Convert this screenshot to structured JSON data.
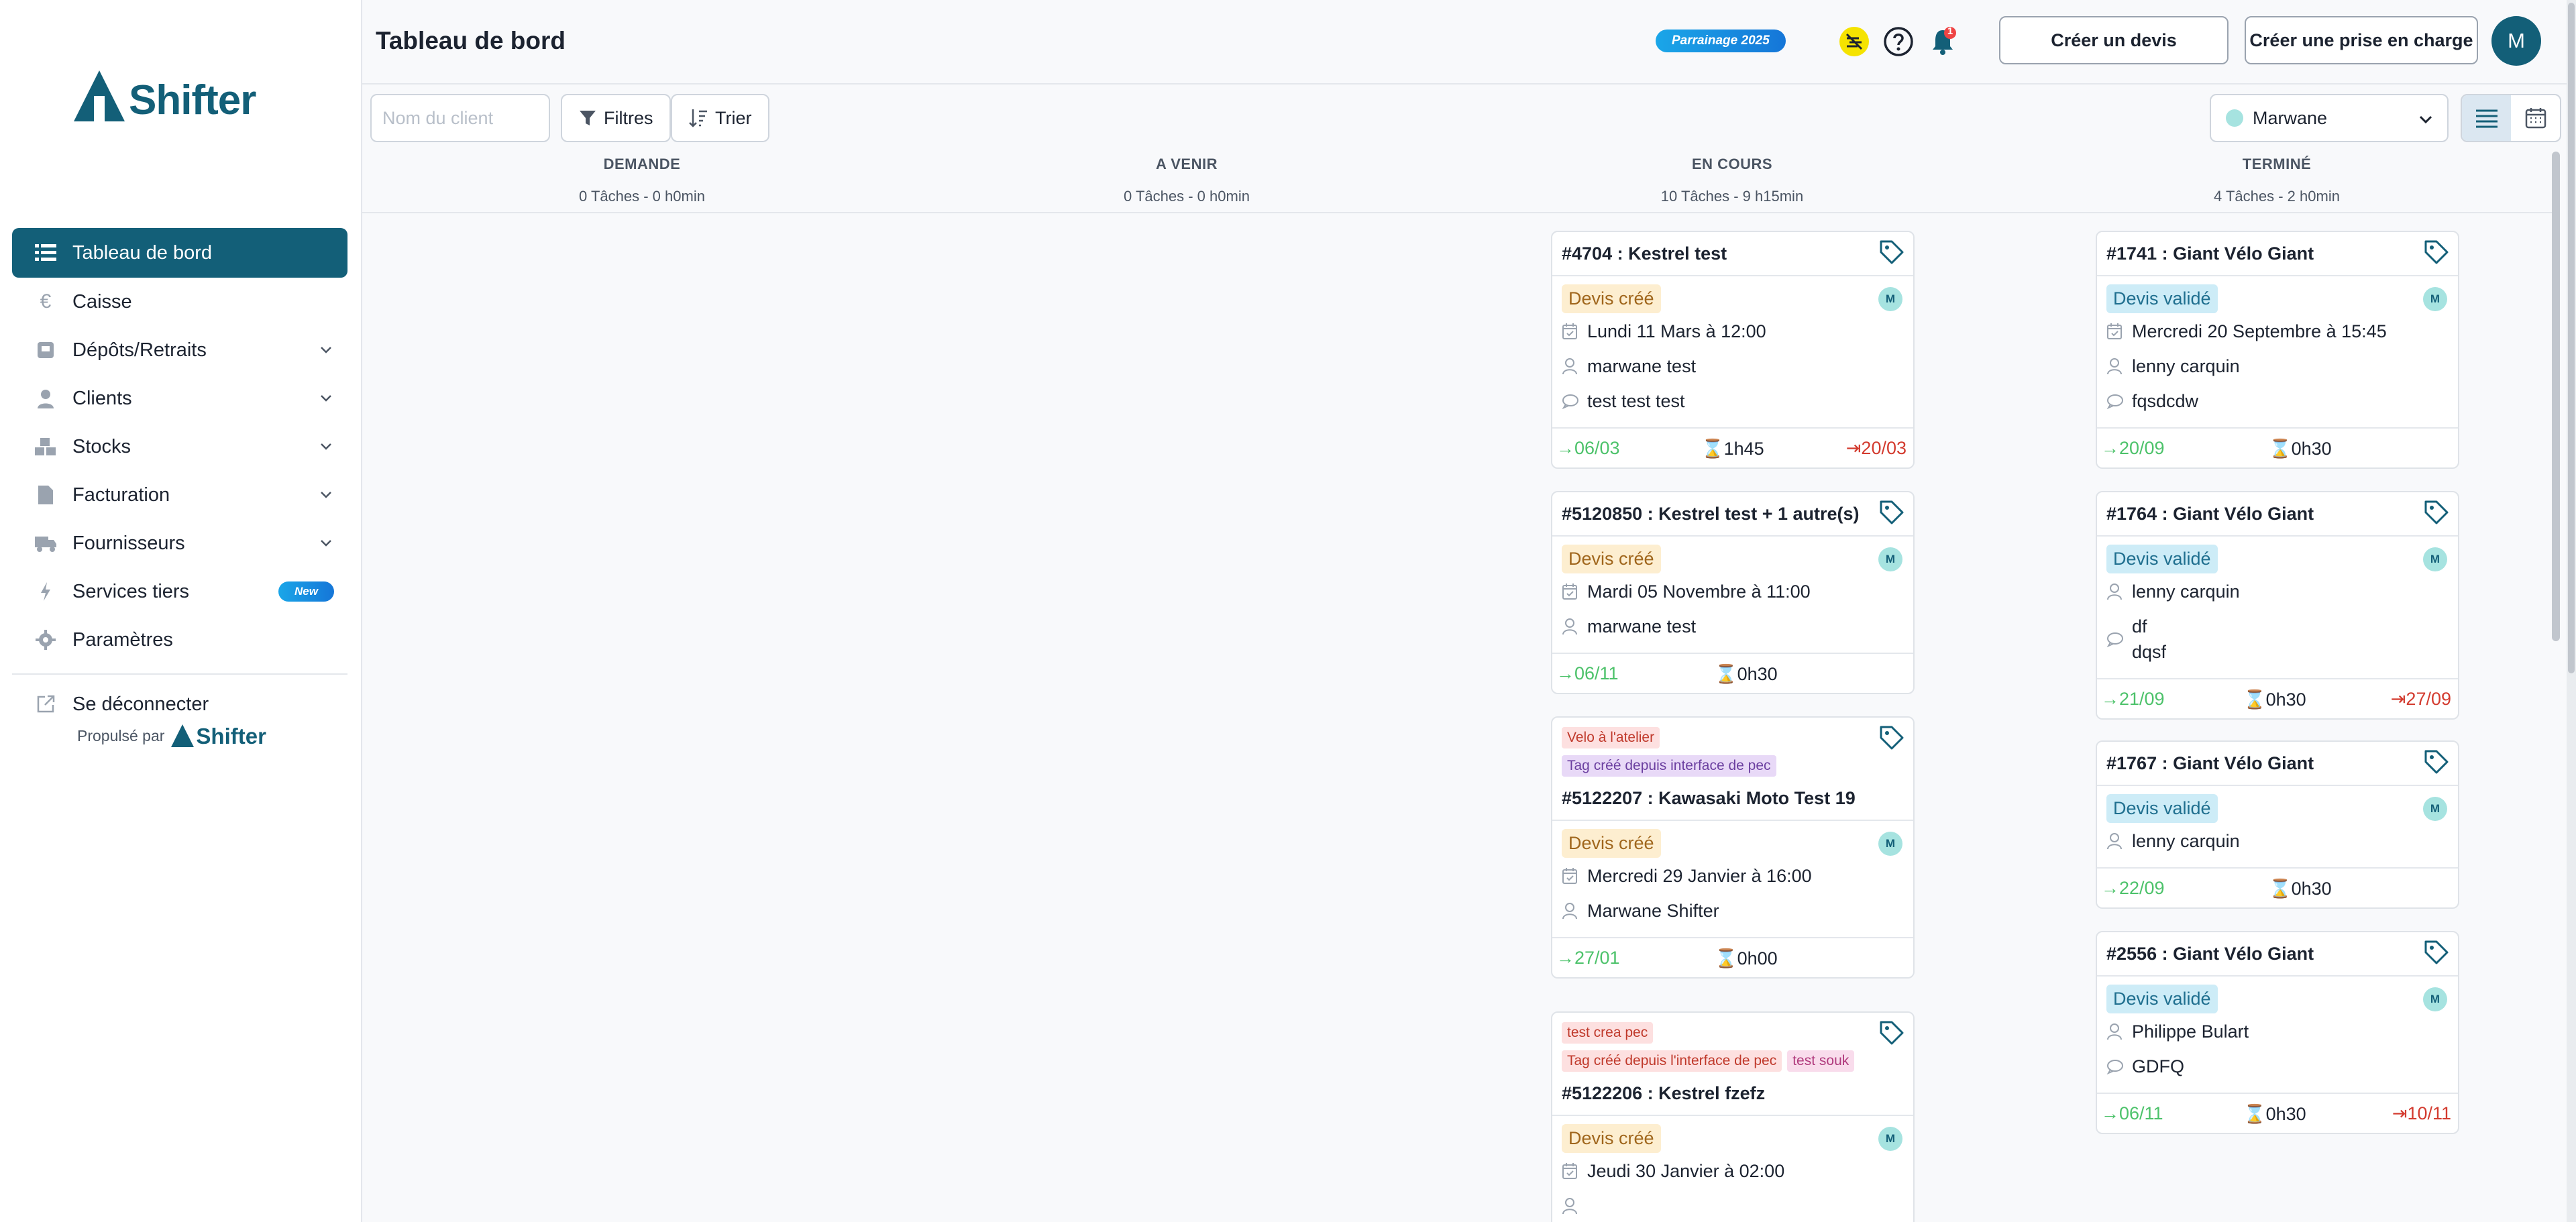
{
  "sidebar": {
    "logo_text": "Shifter",
    "items": [
      {
        "label": "Tableau de bord",
        "icon": "list-icon",
        "active": true
      },
      {
        "label": "Caisse",
        "icon": "euro-icon"
      },
      {
        "label": "Dépôts/Retraits",
        "icon": "deposit-icon",
        "expandable": true
      },
      {
        "label": "Clients",
        "icon": "user-icon",
        "expandable": true
      },
      {
        "label": "Stocks",
        "icon": "cubes-icon",
        "expandable": true
      },
      {
        "label": "Facturation",
        "icon": "file-icon",
        "expandable": true
      },
      {
        "label": "Fournisseurs",
        "icon": "truck-icon",
        "expandable": true
      },
      {
        "label": "Services tiers",
        "icon": "bolt-icon",
        "badge": "New"
      },
      {
        "label": "Paramètres",
        "icon": "gear-icon"
      }
    ],
    "logout_label": "Se déconnecter",
    "powered_by": "Propulsé par",
    "powered_logo": "Shifter"
  },
  "header": {
    "title": "Tableau de bord",
    "promo_badge": "Parrainage 2025",
    "notification_count": "1",
    "create_quote_label": "Créer un devis",
    "create_intake_label": "Créer une prise en charge",
    "avatar_initial": "M"
  },
  "toolbar": {
    "search_placeholder": "Nom du client",
    "filters_label": "Filtres",
    "sort_label": "Trier",
    "user_select_value": "Marwane"
  },
  "columns": [
    {
      "title": "DEMANDE",
      "summary": "0 Tâches - 0 h0min"
    },
    {
      "title": "A VENIR",
      "summary": "0 Tâches - 0 h0min"
    },
    {
      "title": "EN COURS",
      "summary": "10 Tâches - 9 h15min"
    },
    {
      "title": "TERMINÉ",
      "summary": "4 Tâches - 2 h0min"
    }
  ],
  "cards_en_cours": [
    {
      "title": "#4704 : Kestrel  test",
      "status": "Devis créé",
      "date": "Lundi 11 Mars à 12:00",
      "client": "marwane test",
      "comment": "test test test",
      "in": "06/03",
      "duration": "1h45",
      "out": "20/03",
      "avatar": "M"
    },
    {
      "title": "#5120850 : Kestrel  test + 1 autre(s)",
      "status": "Devis créé",
      "date": "Mardi 05 Novembre à 11:00",
      "client": "marwane test",
      "in": "06/11",
      "duration": "0h30",
      "avatar": "M"
    },
    {
      "tags": [
        "Velo à l'atelier",
        "Tag créé depuis interface de pec"
      ],
      "title": "#5122207 : Kawasaki  Moto Test 19",
      "status": "Devis créé",
      "date": "Mercredi 29 Janvier à 16:00",
      "client": "Marwane Shifter",
      "in": "27/01",
      "duration": "0h00",
      "avatar": "M"
    },
    {
      "tags": [
        "test crea pec",
        "Tag créé depuis l'interface de pec",
        "test souk"
      ],
      "title": "#5122206 : Kestrel  fzefz",
      "status": "Devis créé",
      "date": "Jeudi 30 Janvier à 02:00",
      "avatar": "M"
    }
  ],
  "cards_termine": [
    {
      "title": "#1741 : Giant  Vélo Giant",
      "status": "Devis validé",
      "date": "Mercredi 20 Septembre à 15:45",
      "client": "lenny carquin",
      "comment": "fqsdcdw",
      "in": "20/09",
      "duration": "0h30",
      "avatar": "M"
    },
    {
      "title": "#1764 : Giant  Vélo Giant",
      "status": "Devis validé",
      "client": "lenny carquin",
      "comment": "df",
      "comment2": "dqsf",
      "in": "21/09",
      "duration": "0h30",
      "out": "27/09",
      "avatar": "M"
    },
    {
      "title": "#1767 : Giant  Vélo Giant",
      "status": "Devis validé",
      "client": "lenny carquin",
      "in": "22/09",
      "duration": "0h30",
      "avatar": "M"
    },
    {
      "title": "#2556 : Giant  Vélo Giant",
      "status": "Devis validé",
      "client": "Philippe Bulart",
      "comment": "GDFQ",
      "in": "06/11",
      "duration": "0h30",
      "out": "10/11",
      "avatar": "M"
    }
  ]
}
